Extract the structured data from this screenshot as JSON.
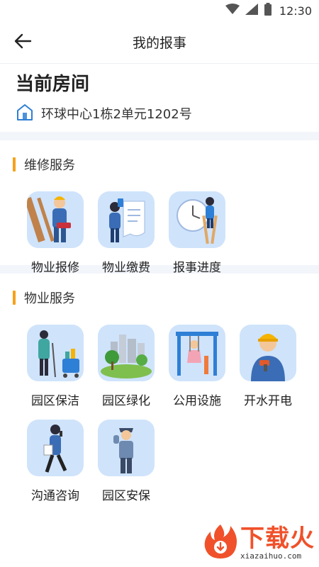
{
  "status_bar": {
    "time": "12:30",
    "icons": [
      "wifi-icon",
      "cellular-signal-icon",
      "battery-icon"
    ]
  },
  "header": {
    "title": "我的报事",
    "back_icon": "arrow-left-icon"
  },
  "room": {
    "heading": "当前房间",
    "address": "环球中心1栋2单元1202号",
    "address_icon": "house-icon"
  },
  "sections": [
    {
      "title": "维修服务",
      "tiles": [
        {
          "label": "物业报修",
          "icon": "repair-worker-illustration"
        },
        {
          "label": "物业缴费",
          "icon": "payment-bill-illustration"
        },
        {
          "label": "报事进度",
          "icon": "progress-clock-illustration"
        }
      ]
    },
    {
      "title": "物业服务",
      "tiles": [
        {
          "label": "园区保洁",
          "icon": "cleaning-illustration"
        },
        {
          "label": "园区绿化",
          "icon": "greening-illustration"
        },
        {
          "label": "公用设施",
          "icon": "public-facilities-illustration"
        },
        {
          "label": "开水开电",
          "icon": "electrician-illustration"
        },
        {
          "label": "沟通咨询",
          "icon": "consultation-illustration"
        },
        {
          "label": "园区安保",
          "icon": "security-guard-illustration"
        }
      ]
    }
  ],
  "colors": {
    "accent_bar": "#f6a21a",
    "tile_bg": "#cfe3fb",
    "divider": "#f2f5fa",
    "icon_blue": "#2e7fd6",
    "watermark": "#f0512a"
  },
  "watermark": {
    "title": "下载火",
    "url": "xiazaihuo.com"
  }
}
